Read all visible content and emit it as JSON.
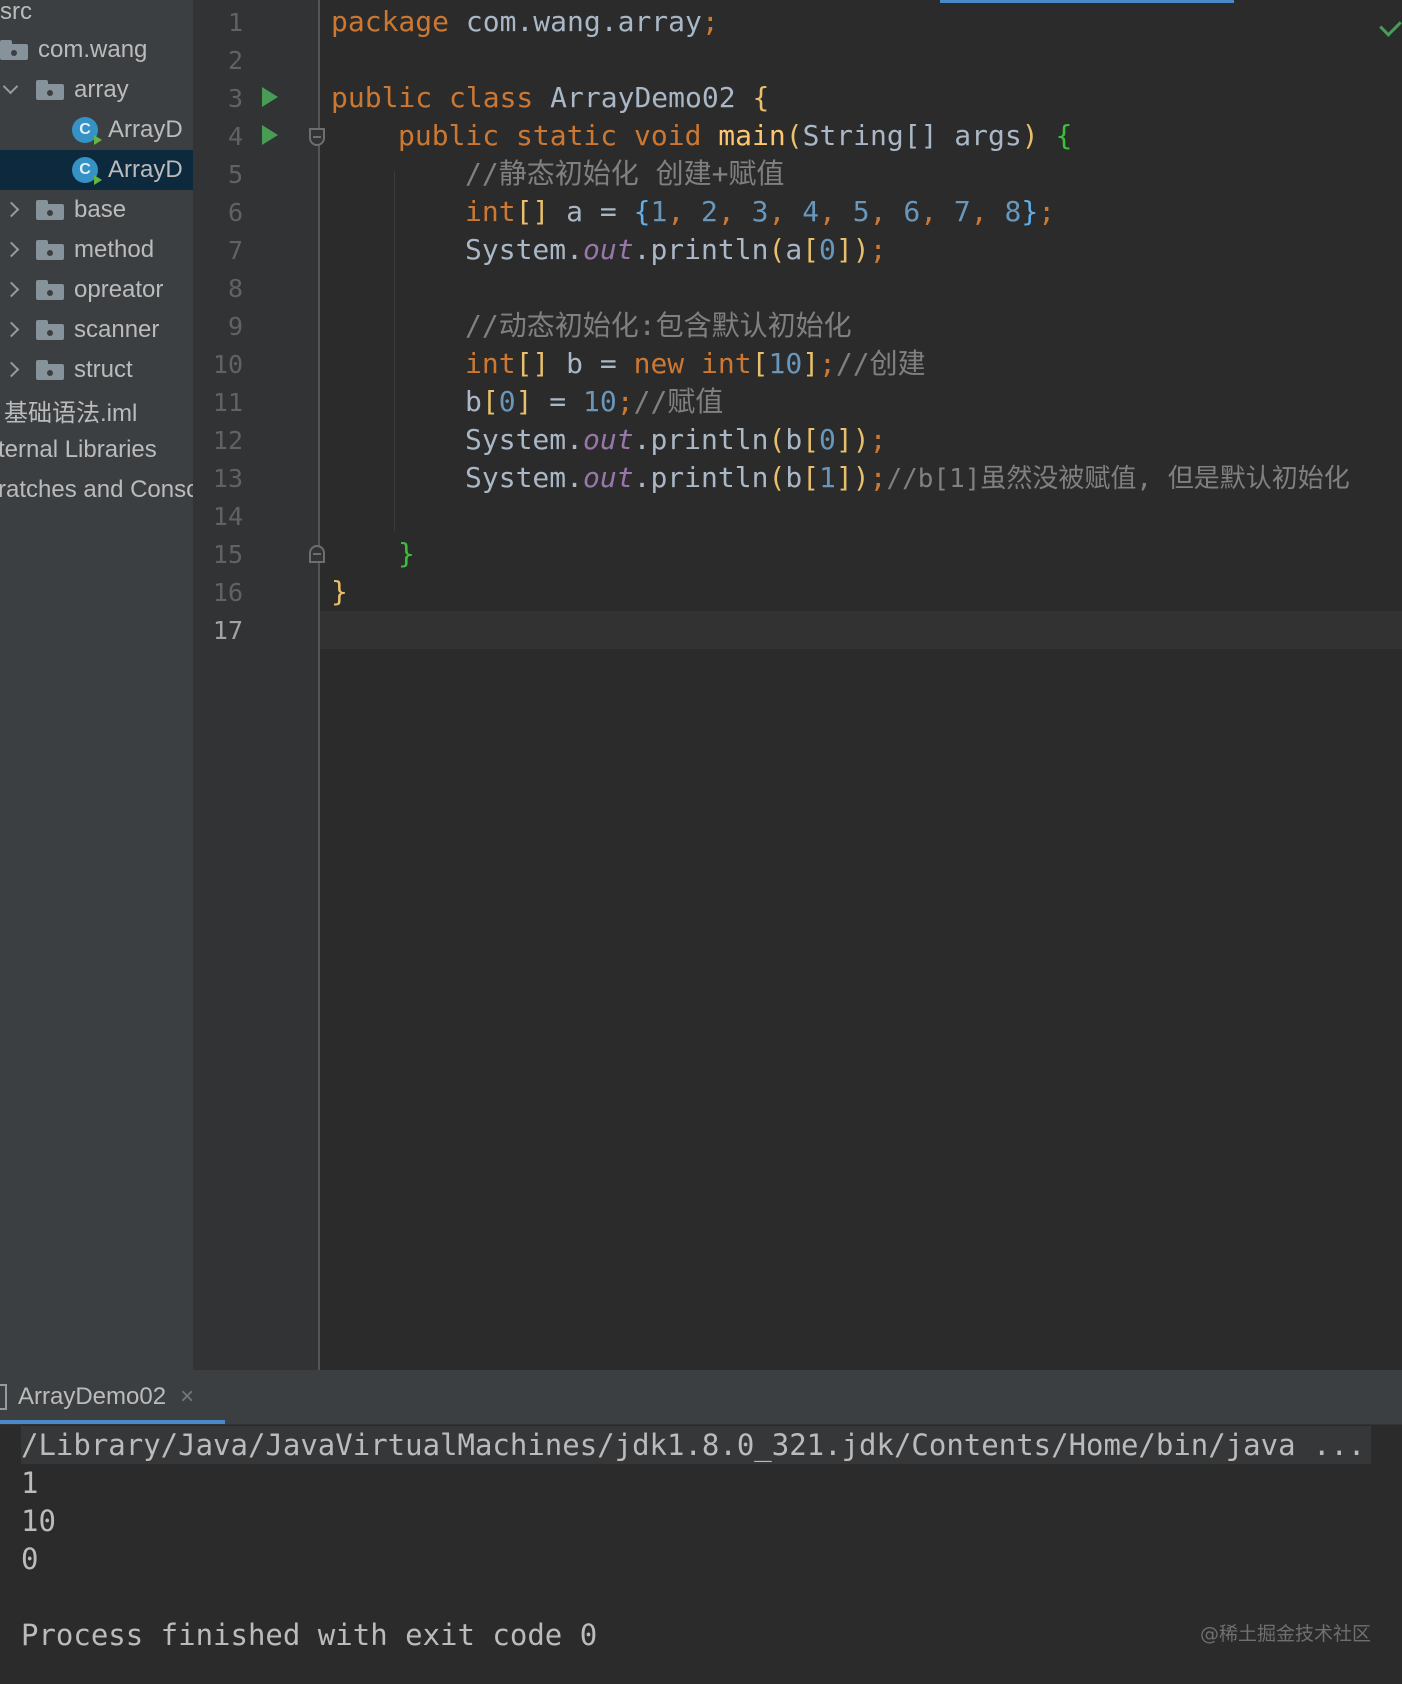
{
  "project_tree": {
    "items": [
      {
        "label": "src"
      },
      {
        "label": "com.wang"
      },
      {
        "label": "array"
      },
      {
        "label": "ArrayD"
      },
      {
        "label": "ArrayD"
      },
      {
        "label": "base"
      },
      {
        "label": "method"
      },
      {
        "label": "opreator"
      },
      {
        "label": "scanner"
      },
      {
        "label": "struct"
      },
      {
        "label": "基础语法.iml"
      },
      {
        "label": "ternal Libraries"
      },
      {
        "label": "ratches and Conso"
      }
    ]
  },
  "editor": {
    "line_numbers": [
      "1",
      "2",
      "3",
      "4",
      "5",
      "6",
      "7",
      "8",
      "9",
      "10",
      "11",
      "12",
      "13",
      "14",
      "15",
      "16",
      "17"
    ],
    "current_line": "17",
    "code": {
      "l1": {
        "kw": "package",
        "rest": " com.wang.array",
        "semi": ";"
      },
      "l3": {
        "kw": "public class",
        "name": " ArrayDemo02 ",
        "brace": "{"
      },
      "l4": {
        "kw": "public static void",
        "fn": " main",
        "p1": "(",
        "params": "String[] args",
        "p2": ")",
        "brace": " {"
      },
      "l5": {
        "comment": "//静态初始化 创建+赋值"
      },
      "l6": {
        "type": "int",
        "br": "[]",
        "rest": " a = ",
        "ob": "{",
        "vals": [
          "1",
          "2",
          "3",
          "4",
          "5",
          "6",
          "7",
          "8"
        ],
        "cb": "}",
        "semi": ";"
      },
      "l7": {
        "obj": "System.",
        "fld": "out",
        "call": ".println",
        "p1": "(",
        "arg": "a",
        "ib1": "[",
        "idx": "0",
        "ib2": "]",
        "p2": ")",
        "semi": ";"
      },
      "l9": {
        "comment": "//动态初始化:包含默认初始化"
      },
      "l10": {
        "type": "int",
        "br": "[]",
        "rest": " b = ",
        "kw": "new",
        "type2": " int",
        "ib1": "[",
        "idx": "10",
        "ib2": "]",
        "semi": ";",
        "comment": "//创建"
      },
      "l11": {
        "var": "b",
        "ib1": "[",
        "idx": "0",
        "ib2": "]",
        "rest": " = ",
        "val": "10",
        "semi": ";",
        "comment": "//赋值"
      },
      "l12": {
        "obj": "System.",
        "fld": "out",
        "call": ".println",
        "p1": "(",
        "arg": "b",
        "ib1": "[",
        "idx": "0",
        "ib2": "]",
        "p2": ")",
        "semi": ";"
      },
      "l13": {
        "obj": "System.",
        "fld": "out",
        "call": ".println",
        "p1": "(",
        "arg": "b",
        "ib1": "[",
        "idx": "1",
        "ib2": "]",
        "p2": ")",
        "semi": ";",
        "comment": "//b[1]虽然没被赋值, 但是默认初始化"
      },
      "l15": {
        "brace": "}"
      },
      "l16": {
        "brace": "}"
      }
    }
  },
  "run_panel": {
    "tab_label": "ArrayDemo02",
    "close_glyph": "×",
    "command": "/Library/Java/JavaVirtualMachines/jdk1.8.0_321.jdk/Contents/Home/bin/java ...",
    "output_lines": [
      "1",
      "10",
      "0"
    ],
    "exit_message": "Process finished with exit code 0"
  },
  "watermark": "@稀土掘金技术社区",
  "colors": {
    "keyword": "#cc7832",
    "number": "#6897bb",
    "comment": "#808080",
    "field": "#9876aa",
    "method": "#ffc66d",
    "background": "#2b2b2b",
    "run_icon": "#499c54"
  }
}
